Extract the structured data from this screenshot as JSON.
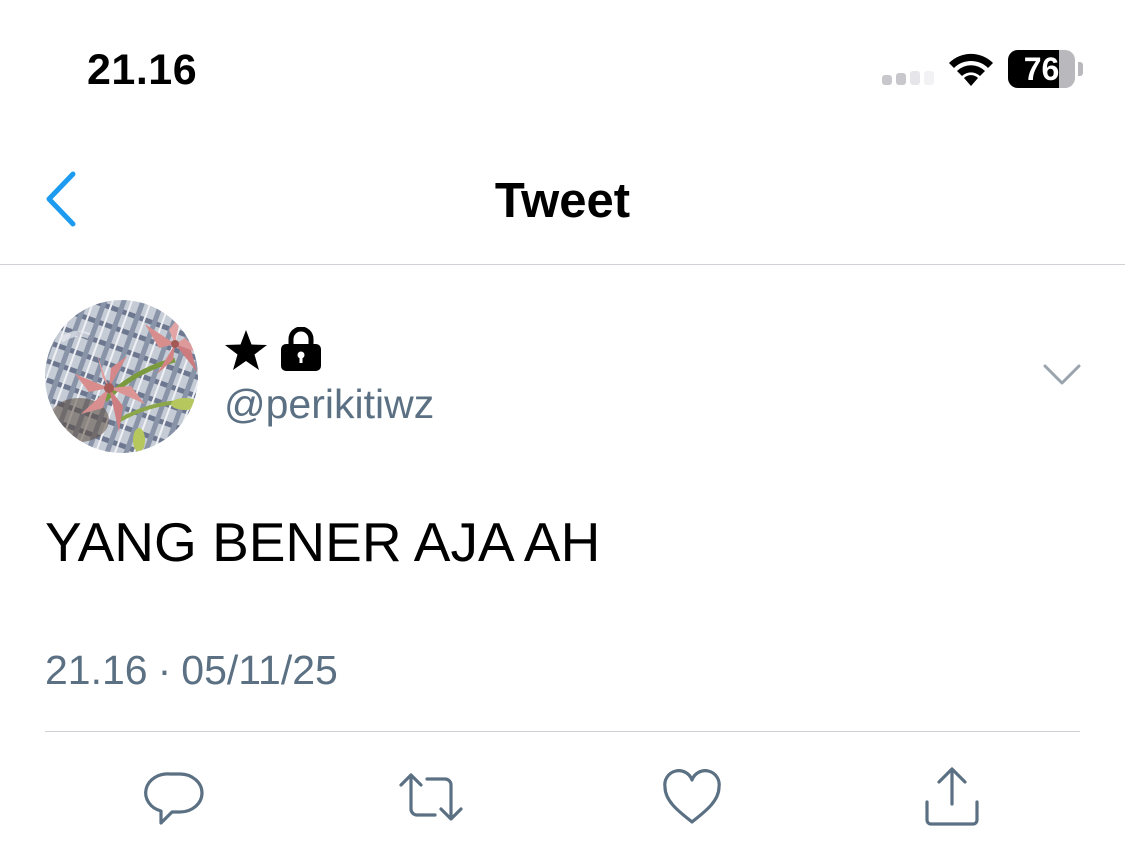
{
  "status_bar": {
    "time": "21.16",
    "battery_level": "76",
    "battery_fraction": 0.76,
    "signal_icon": "cellular-signal-icon",
    "wifi_icon": "wifi-icon"
  },
  "nav": {
    "title": "Tweet",
    "back_icon": "chevron-left-icon"
  },
  "tweet": {
    "display_name_icons": [
      "star-icon",
      "lock-icon"
    ],
    "handle": "@perikitiwz",
    "text": "YANG BENER AJA AH",
    "time": "21.16",
    "separator": "·",
    "date": "05/11/25",
    "more_icon": "chevron-down-icon"
  },
  "actions": {
    "reply_icon": "reply-icon",
    "retweet_icon": "retweet-icon",
    "like_icon": "heart-icon",
    "share_icon": "share-icon"
  },
  "colors": {
    "accent": "#1d9bf0",
    "secondary_text": "#5b7083",
    "divider": "#cfd3d7"
  }
}
